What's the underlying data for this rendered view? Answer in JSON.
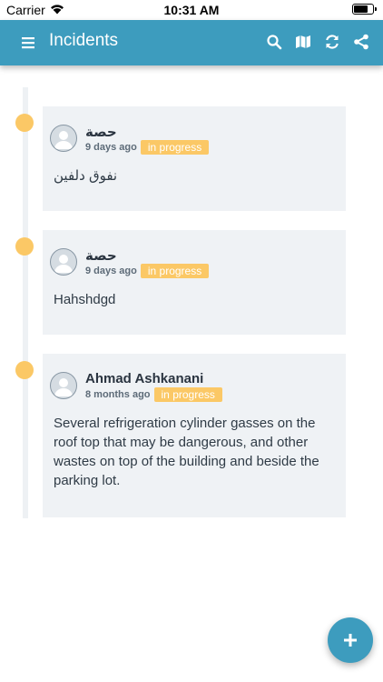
{
  "status_bar": {
    "carrier": "Carrier",
    "time": "10:31 AM"
  },
  "app_bar": {
    "title": "Incidents",
    "icons": [
      "menu-icon",
      "search-icon",
      "map-icon",
      "refresh-icon",
      "share-icon"
    ]
  },
  "incidents": [
    {
      "author": "حصة",
      "time_ago": "9 days ago",
      "status": "in progress",
      "text": "نفوق دلفين"
    },
    {
      "author": "حصة",
      "time_ago": "9 days ago",
      "status": "in progress",
      "text": "Hahshdgd"
    },
    {
      "author": "Ahmad Ashkanani",
      "time_ago": "8 months ago",
      "status": "in progress",
      "text": "Several refrigeration cylinder gasses on the roof top that may be dangerous, and other wastes on top of the building and beside the parking lot."
    }
  ],
  "fab": {
    "icon": "plus-icon"
  },
  "colors": {
    "primary": "#3d9cbe",
    "status_in_progress": "#fbc866",
    "card_bg": "#eff2f5"
  }
}
